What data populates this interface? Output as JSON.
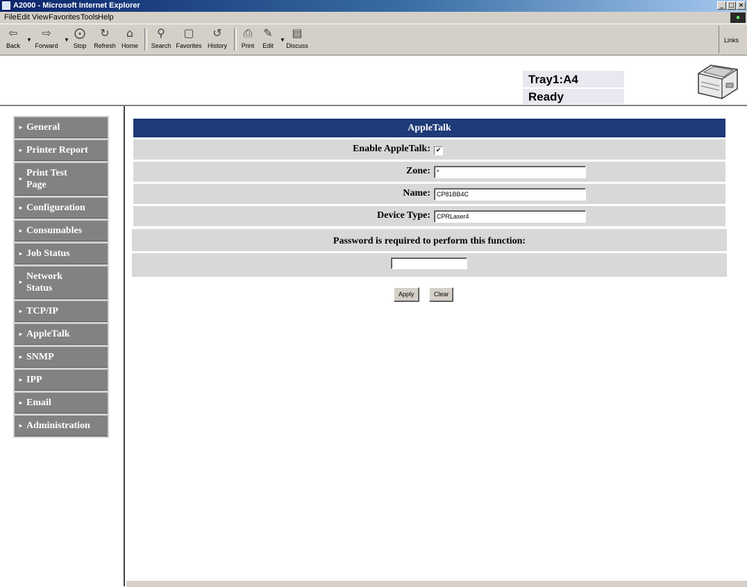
{
  "window": {
    "title": "A2000 - Microsoft Internet Explorer",
    "buttons": [
      "_",
      "□",
      "×"
    ]
  },
  "menu": [
    "File",
    "Edit",
    "View",
    "Favorites",
    "Tools",
    "Help"
  ],
  "toolbar": {
    "back": "Back",
    "forward": "Forward",
    "stop": "Stop",
    "refresh": "Refresh",
    "home": "Home",
    "search": "Search",
    "favorites": "Favorites",
    "history": "History",
    "print": "Print",
    "edit": "Edit",
    "discuss": "Discuss",
    "links": "Links"
  },
  "status": {
    "tray": "Tray1:A4",
    "state": "Ready"
  },
  "nav": {
    "items": [
      {
        "label": "General"
      },
      {
        "label": "Printer Report"
      },
      {
        "label": "Print Test Page"
      },
      {
        "label": "Configuration"
      },
      {
        "label": "Consumables"
      },
      {
        "label": "Job Status"
      },
      {
        "label": "Network Status"
      },
      {
        "label": "TCP/IP"
      },
      {
        "label": "AppleTalk"
      },
      {
        "label": "SNMP"
      },
      {
        "label": "IPP"
      },
      {
        "label": "Email"
      },
      {
        "label": "Administration"
      }
    ]
  },
  "form": {
    "heading": "AppleTalk",
    "enable_label": "Enable AppleTalk:",
    "enable_checked": "✔",
    "zone_label": "Zone:",
    "zone_value": "*",
    "name_label": "Name:",
    "name_value": "CP81BB4C",
    "device_label": "Device Type:",
    "device_value": "CPRLaser4",
    "password_label": "Password is required to perform this function:",
    "password_value": "",
    "apply": "Apply",
    "clear": "Clear"
  }
}
